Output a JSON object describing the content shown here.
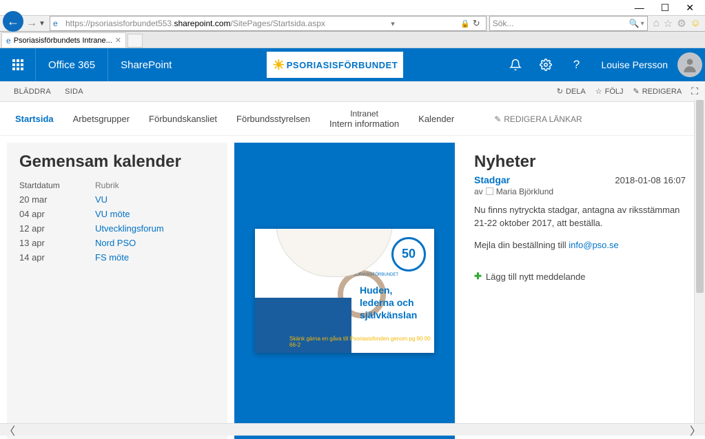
{
  "window": {
    "min": "—",
    "max": "☐",
    "close": "✕"
  },
  "browser": {
    "url_pre": "https://psoriasisforbundet553.",
    "url_strong": "sharepoint.com",
    "url_post": "/SitePages/Startsida.aspx",
    "search_placeholder": "Sök...",
    "tab_title": "Psoriasisförbundets Intrane..."
  },
  "suite": {
    "o365": "Office 365",
    "sp": "SharePoint",
    "brand": "PSORIASISFÖRBUNDET",
    "user": "Louise Persson"
  },
  "ribbon": {
    "tab1": "BLÄDDRA",
    "tab2": "SIDA",
    "share": "DELA",
    "follow": "FÖLJ",
    "edit": "REDIGERA"
  },
  "nav": {
    "items": [
      "Startsida",
      "Arbetsgrupper",
      "Förbundskansliet",
      "Förbundsstyrelsen"
    ],
    "intranet_top": "Intranet",
    "intranet_bottom": "Intern information",
    "kalender": "Kalender",
    "edit_links": "REDIGERA LÄNKAR"
  },
  "calendar": {
    "title": "Gemensam kalender",
    "col_date": "Startdatum",
    "col_head": "Rubrik",
    "rows": [
      {
        "date": "20 mar",
        "title": "VU"
      },
      {
        "date": "04 apr",
        "title": "VU möte"
      },
      {
        "date": "12 apr",
        "title": "Utvecklingsforum"
      },
      {
        "date": "13 apr",
        "title": "Nord PSO"
      },
      {
        "date": "14 apr",
        "title": "FS möte"
      }
    ]
  },
  "promo": {
    "badge": "50",
    "sublogo": "PSORIASISFÖRBUNDET",
    "headline": "Huden, lederna och självkänslan",
    "donate": "Skänk gärna en gåva till Psoriasisfonden genom pg 90 00 66-2"
  },
  "news": {
    "title": "Nyheter",
    "item_title": "Stadgar",
    "item_date": "2018-01-08 16:07",
    "by_label": "av",
    "author": "Maria Björklund",
    "body1": "Nu finns nytryckta stadgar, antagna av riksstämman 21-22 oktober 2017, att beställa.",
    "body2_pre": "Mejla din beställning till ",
    "body2_link": "info@pso.se",
    "add": "Lägg till nytt meddelande"
  }
}
